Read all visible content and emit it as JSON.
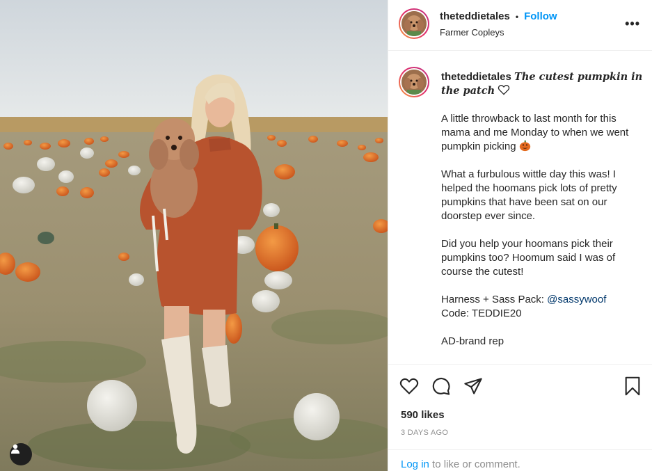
{
  "post": {
    "username": "theteddietales",
    "follow_label": "Follow",
    "separator": "•",
    "location": "Farmer Copleys",
    "more_label": "•••"
  },
  "caption": {
    "username": "theteddietales",
    "title": "The cutest pumpkin in the patch",
    "paragraph1": "A little throwback to last month for this mama and me Monday to when we went pumpkin picking",
    "paragraph2": "What a furbulous wittle day this was! I helped the hoomans pick lots of pretty pumpkins that have been sat on our doorstep ever since.",
    "paragraph3": "Did you help your hoomans pick their pumpkins too? Hoomum said I was of course the cutest!",
    "harness_prefix": "Harness + Sass Pack: ",
    "mention": "@sassywoof",
    "code_line": "Code: TEDDIE20",
    "ad_line": "AD-brand rep"
  },
  "engagement": {
    "likes": "590 likes",
    "timestamp": "3 DAYS AGO"
  },
  "comment": {
    "login_label": "Log in",
    "suffix": " to like or comment."
  },
  "colors": {
    "accent": "#0095f6",
    "mention": "#00376b",
    "muted": "#8e8e8e",
    "pumpkin": "#e36a1d"
  },
  "icons": [
    "heart-icon",
    "comment-icon",
    "share-icon",
    "bookmark-icon",
    "user-tag-icon",
    "more-icon"
  ]
}
